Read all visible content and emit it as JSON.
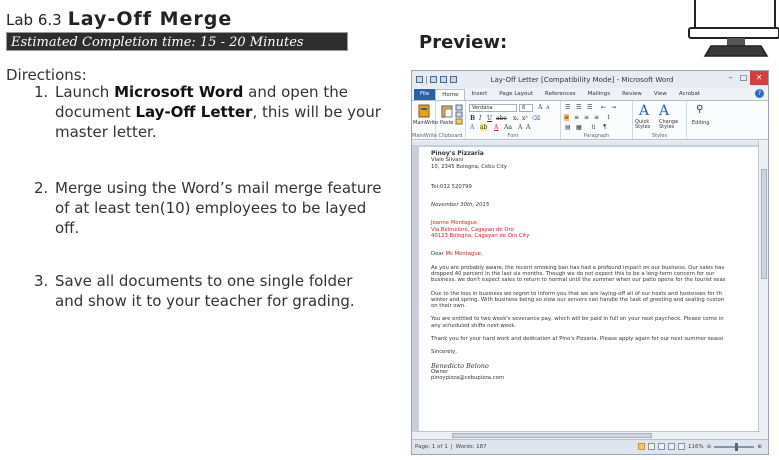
{
  "lab": {
    "number": "Lab 6.3",
    "name": "Lay-Off Merge",
    "estimated_time": "Estimated Completion time: 15 - 20 Minutes",
    "directions_label": "Directions:",
    "steps": [
      {
        "num": "1.",
        "t1": "Launch ",
        "b1": "Microsoft Word",
        "t2": " and open the document ",
        "b2": "Lay-Off Letter",
        "t3": ", this will be your master letter."
      },
      {
        "num": "2.",
        "text": "Merge using the Word’s mail merge feature of at least ten(10) employees to be layed off."
      },
      {
        "num": "3.",
        "text": "Save all documents to one single folder and show it to your teacher for grading."
      }
    ]
  },
  "preview_label": "Preview:",
  "word": {
    "title": "Lay-Off Letter [Compatibility Mode] - Microsoft Word",
    "tabs": [
      "File",
      "Home",
      "Insert",
      "Page Layout",
      "References",
      "Mailings",
      "Review",
      "View",
      "Acrobat"
    ],
    "ribbon": {
      "mainwrite": "MainWrite",
      "paste": "Paste",
      "clipboard": "Clipboard",
      "font_name": "Verdana",
      "font_size": "8",
      "font_group": "Font",
      "paragraph_group": "Paragraph",
      "quick_styles": "Quick Styles",
      "change_styles": "Change Styles",
      "styles_group": "Styles",
      "editing": "Editing"
    },
    "letter": {
      "company": "Pinoy's Pizzaria",
      "addr1": "Viale Silvani",
      "addr2": "10, 2345 Bologna, Cebu City",
      "tel": "Tel:032 520799",
      "date": "November 30th, 2015",
      "recipient_name": "Joanne Montague",
      "recipient_addr1": "Via Belmeloro, Cagayan de Oro",
      "recipient_addr2": "40123 Bologna, Cagayan de Oro City",
      "salutation_pre": "Dear ",
      "salutation_name": "Ms Montague",
      "salutation_post": ",",
      "p1_l1": "As you are probably aware, the recent smoking ban has had a profound impact on our business. Our sales hav",
      "p1_l2": "dropped 40 percent in the last six months. Though we do not expect this to be a long-term concern for our",
      "p1_l3": "business, we don't expect sales to return to normal until the summer when our patio opens for the tourist seas",
      "p2_l1": "Due to the loss in business we regret to inform you that we are laying-off all of our hosts and hostesses for th",
      "p2_l2": "winter and spring. With business being so slow our servers can handle the task of greeting and seating custon",
      "p2_l3": "on their own.",
      "p3_l1": "You are entitled to two week's severance pay, which will be paid in full on your next paycheck. Please come in",
      "p3_l2": "any scheduled shifts next week.",
      "p4_l1": "Thank you for your hard work and dedication at Pino's Pizzaria.  Please apply again for our next summer seaso",
      "closing": "Sincerely,",
      "signer": "Benedicto Belono",
      "signer_title": "Owner",
      "signer_email": "pinoypizza@cebupizza.com"
    },
    "status": {
      "page": "Page: 1 of 1",
      "words": "Words: 187",
      "zoom": "116%"
    }
  },
  "colors": {
    "file_tab": "#2b5faa",
    "merge_field_red": "#cc1e1e",
    "estimate_bar": "#2e2e2e"
  }
}
